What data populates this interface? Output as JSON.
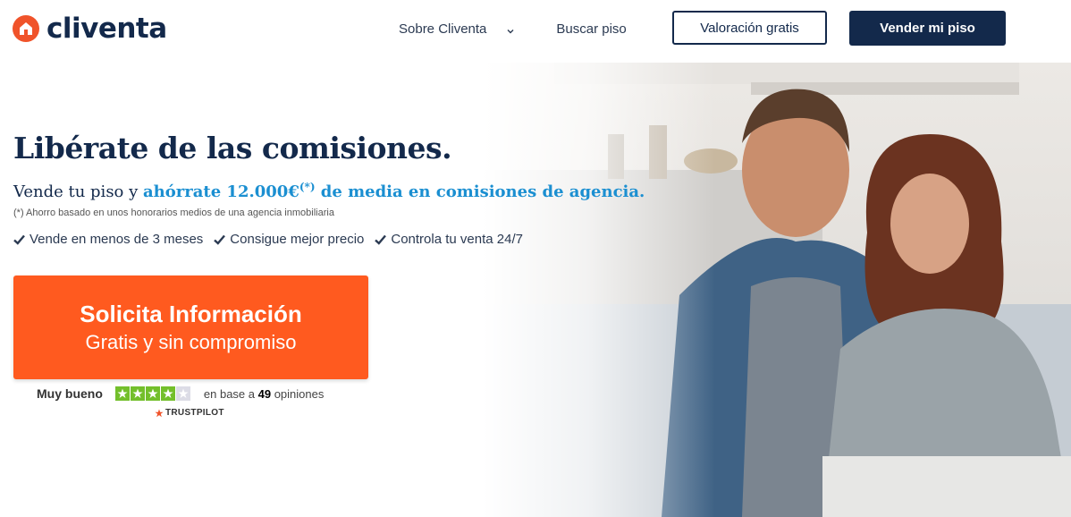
{
  "brand": {
    "name": "cliventa",
    "color": "#f0532a",
    "navy": "#13294b"
  },
  "nav": {
    "items": [
      {
        "label": "Sobre Cliventa",
        "has_dropdown": true
      },
      {
        "label": "Buscar piso"
      }
    ],
    "valoracion_label": "Valoración gratis",
    "vender_label": "Vender mi piso"
  },
  "hero": {
    "title": "Libérate de las comisiones.",
    "subtitle_prefix": "Vende tu piso y ",
    "subtitle_highlight": "ahórrate 12.000€",
    "subtitle_mark": "(*)",
    "subtitle_suffix": " de media en comisiones de agencia.",
    "footnote": "(*) Ahorro basado en unos honorarios medios de una agencia inmobiliaria",
    "checks": [
      "Vende en menos de 3 meses",
      "Consigue mejor precio",
      "Controla tu venta 24/7"
    ],
    "cta": {
      "title": "Solicita Información",
      "subtitle": "Gratis y sin compromiso",
      "color": "#ff5a1f"
    }
  },
  "rating": {
    "label": "Muy bueno",
    "stars_filled": 4,
    "stars_total": 5,
    "prefix": "en base a ",
    "count": "49",
    "suffix": " opiniones",
    "provider": "TRUSTPILOT",
    "star_color": "#73bf2b"
  }
}
